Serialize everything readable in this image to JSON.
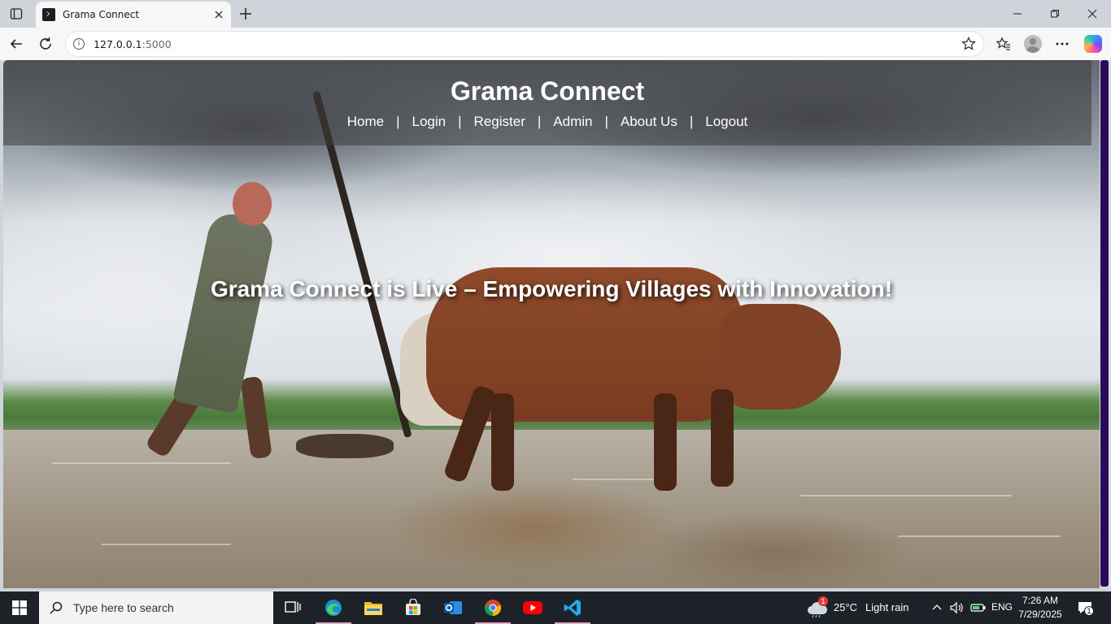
{
  "browser": {
    "tab_title": "Grama Connect",
    "url_host": "127.0.0.1",
    "url_port": ":5000"
  },
  "site": {
    "title": "Grama Connect",
    "nav": [
      {
        "label": "Home"
      },
      {
        "label": "Login"
      },
      {
        "label": "Register"
      },
      {
        "label": "Admin"
      },
      {
        "label": "About Us"
      },
      {
        "label": "Logout"
      }
    ],
    "separator": "|",
    "hero_text": "Grama Connect is Live – Empowering Villages with Innovation!"
  },
  "taskbar": {
    "search_placeholder": "Type here to search",
    "weather_badge": "1",
    "temperature": "25°C",
    "weather": "Light rain",
    "language": "ENG",
    "time": "7:26 AM",
    "date": "7/29/2025",
    "notification_count": "1"
  },
  "colors": {
    "scrollbar_thumb": "#2a0b5a",
    "header_overlay": "rgba(60,60,60,.55)",
    "taskbar": "#1d2128"
  }
}
